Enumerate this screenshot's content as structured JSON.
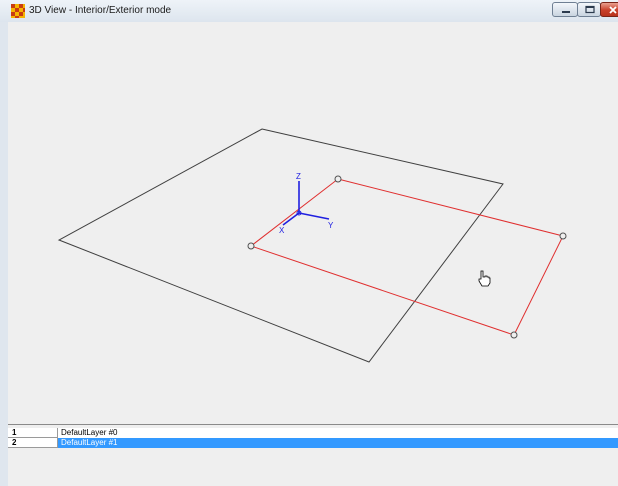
{
  "window": {
    "title": "3D View - Interior/Exterior mode",
    "icon": "checkered-app-icon",
    "controls": {
      "minimize_icon": "minimize-icon",
      "maximize_icon": "maximize-icon",
      "close_icon": "close-icon"
    }
  },
  "viewport": {
    "background_color": "#efefef",
    "axes": {
      "x_label": "X",
      "y_label": "Y",
      "z_label": "Z",
      "color": "#2020e0"
    },
    "floor_plane_color": "#404040",
    "selected_rectangle_color": "#e03030",
    "cursor_icon": "hand-cursor-icon"
  },
  "layers": {
    "rows": [
      {
        "index": "1",
        "name": "DefaultLayer #0",
        "selected": false
      },
      {
        "index": "2",
        "name": "DefaultLayer #1",
        "selected": true
      }
    ],
    "selection_color": "#3399ff"
  }
}
